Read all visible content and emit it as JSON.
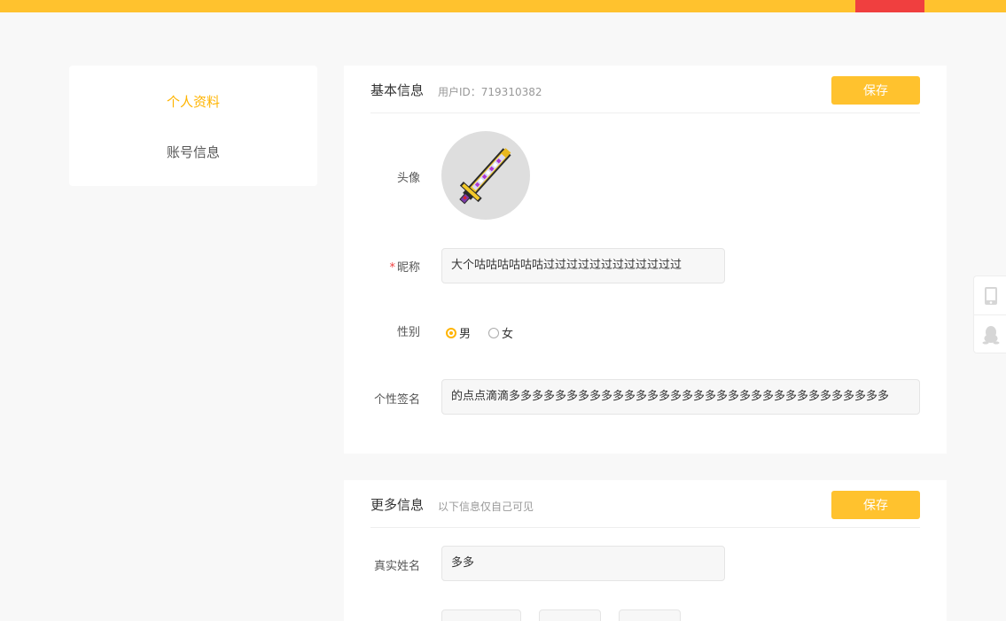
{
  "sidebar": {
    "items": [
      {
        "label": "个人资料",
        "active": true
      },
      {
        "label": "账号信息",
        "active": false
      }
    ]
  },
  "basic": {
    "title": "基本信息",
    "user_id": "用户ID：719310382",
    "save_label": "保存",
    "avatar_label": "头像",
    "nickname_required": "*",
    "nickname_label": "昵称",
    "nickname_value": "大个咕咕咕咕咕咕过过过过过过过过过过过过",
    "gender_label": "性别",
    "gender_options": [
      {
        "label": "男",
        "checked": true
      },
      {
        "label": "女",
        "checked": false
      }
    ],
    "signature_label": "个性签名",
    "signature_value": "的点点滴滴多多多多多多多多多多多多多多多多多多多多多多多多多多多多多多多多多"
  },
  "more": {
    "title": "更多信息",
    "subtitle": "以下信息仅自己可见",
    "save_label": "保存",
    "realname_label": "真实姓名",
    "realname_value": "多多"
  },
  "colors": {
    "accent": "#ffc22e",
    "accent_text": "#ffb400",
    "topbar_red": "#f03f3f"
  },
  "icons": {
    "avatar": "pixel-sword-icon",
    "tool1": "mobile-phone-icon",
    "tool2": "qq-penguin-icon"
  }
}
